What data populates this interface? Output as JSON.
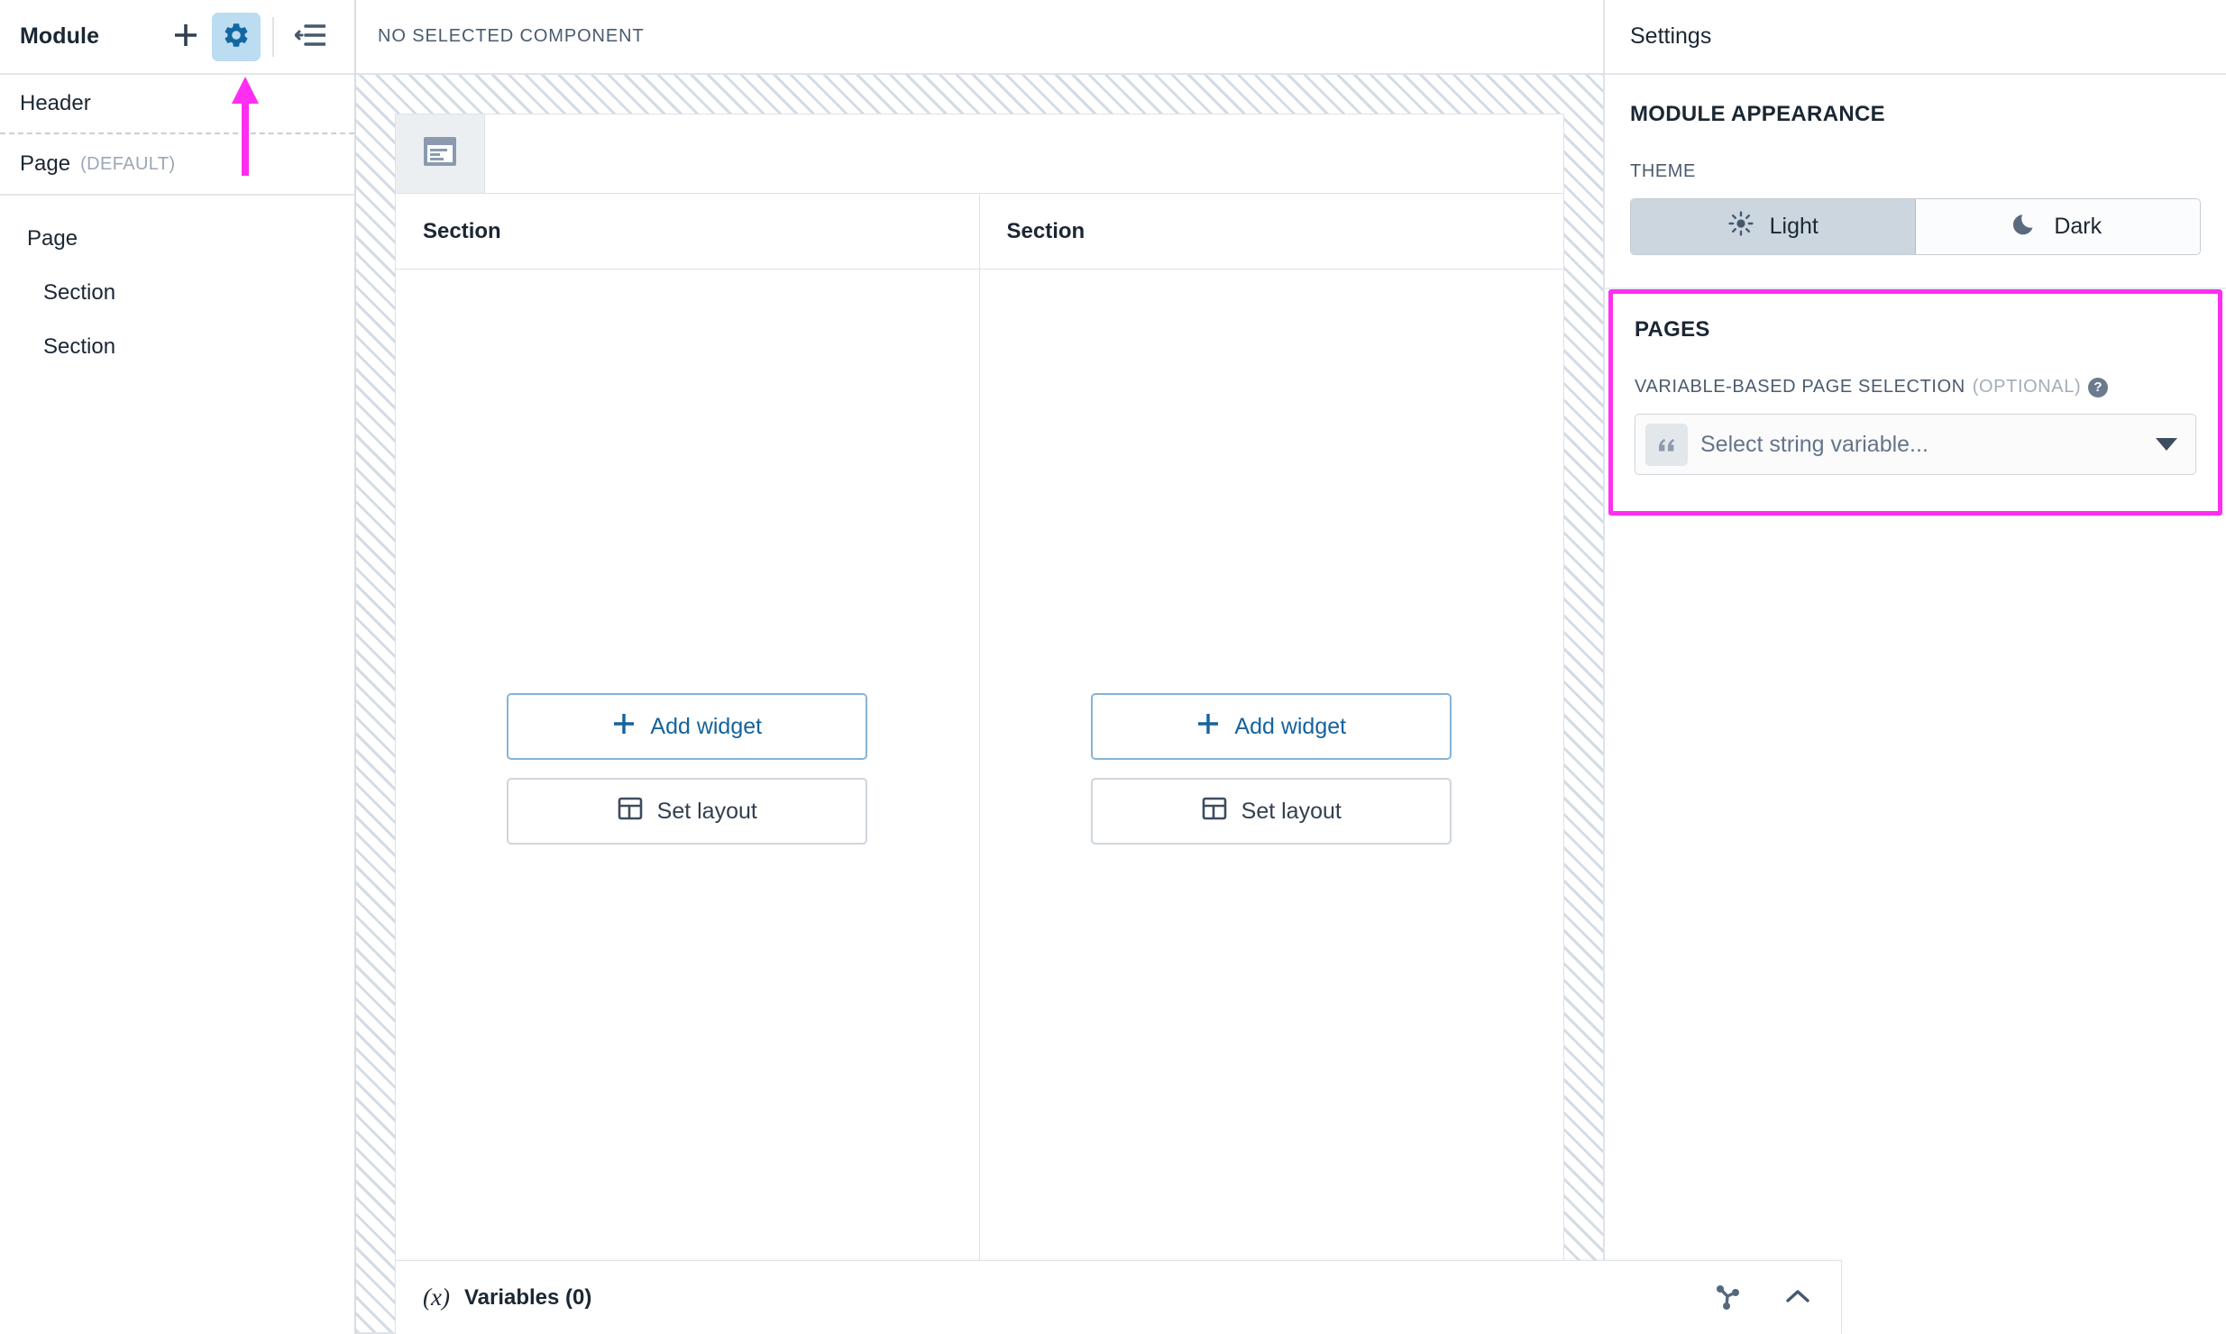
{
  "sidebar": {
    "title": "Module",
    "tools": [
      {
        "name": "add",
        "icon": "plus-icon",
        "active": false
      },
      {
        "name": "settings",
        "icon": "gear-icon",
        "active": true
      },
      {
        "name": "collapse",
        "icon": "collapse-panel-icon",
        "active": false
      }
    ],
    "top_tree": [
      {
        "label": "Header",
        "suffix": ""
      },
      {
        "label": "Page",
        "suffix": "(DEFAULT)"
      }
    ],
    "tree": [
      {
        "label": "Page",
        "depth": 1
      },
      {
        "label": "Section",
        "depth": 2
      },
      {
        "label": "Section",
        "depth": 2
      }
    ]
  },
  "center": {
    "header_label": "NO SELECTED COMPONENT",
    "page_tab_icon": "page-icon",
    "sections": [
      {
        "title": "Section",
        "add_widget_label": "Add widget",
        "set_layout_label": "Set layout"
      },
      {
        "title": "Section",
        "add_widget_label": "Add widget",
        "set_layout_label": "Set layout"
      }
    ]
  },
  "variables_bar": {
    "icon": "italic-x-icon",
    "label": "Variables (0)",
    "actions": [
      {
        "name": "dependency-graph",
        "icon": "node-graph-icon"
      },
      {
        "name": "collapse",
        "icon": "chevron-up-icon"
      }
    ]
  },
  "settings": {
    "title": "Settings",
    "module_appearance": {
      "title": "MODULE APPEARANCE",
      "theme_label": "THEME",
      "options": [
        {
          "label": "Light",
          "icon": "sun-icon",
          "selected": true
        },
        {
          "label": "Dark",
          "icon": "moon-icon",
          "selected": false
        }
      ]
    },
    "pages": {
      "title": "PAGES",
      "field_label": "VARIABLE-BASED PAGE SELECTION",
      "field_optional": "(OPTIONAL)",
      "help_glyph": "?",
      "select_placeholder": "Select string variable...",
      "select_badge_icon": "quote-icon",
      "caret_icon": "chevron-down-icon"
    }
  },
  "annotation": {
    "arrow_color": "#ff2ef0",
    "highlight_color": "#ff2ef0"
  }
}
